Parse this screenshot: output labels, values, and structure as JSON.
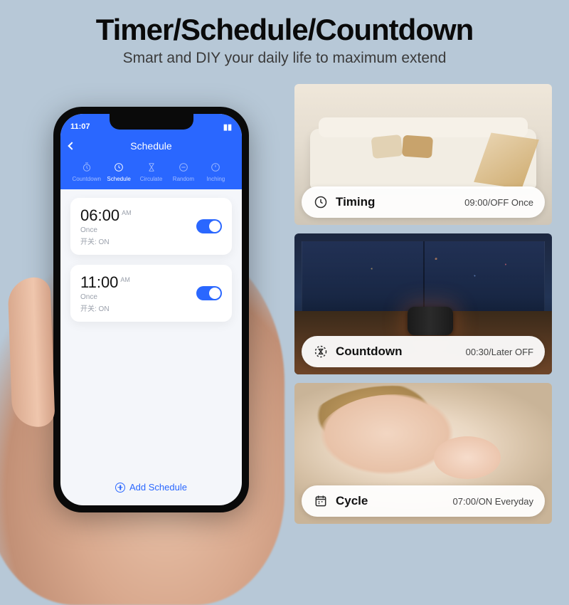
{
  "header": {
    "title": "Timer/Schedule/Countdown",
    "subtitle": "Smart and DIY your daily life to maximum extend"
  },
  "phone": {
    "status_time": "11:07",
    "screen_title": "Schedule",
    "tabs": {
      "countdown": "Countdown",
      "schedule": "Schedule",
      "circulate": "Circulate",
      "random": "Random",
      "inching": "Inching"
    },
    "schedules": [
      {
        "time": "06:00",
        "ampm": "AM",
        "repeat": "Once",
        "state": "开关: ON"
      },
      {
        "time": "11:00",
        "ampm": "AM",
        "repeat": "Once",
        "state": "开关: ON"
      }
    ],
    "add_label": "Add Schedule"
  },
  "panels": {
    "timing": {
      "label": "Timing",
      "value": "09:00/OFF Once"
    },
    "countdown": {
      "label": "Countdown",
      "value": "00:30/Later OFF"
    },
    "cycle": {
      "label": "Cycle",
      "value": "07:00/ON Everyday"
    }
  }
}
